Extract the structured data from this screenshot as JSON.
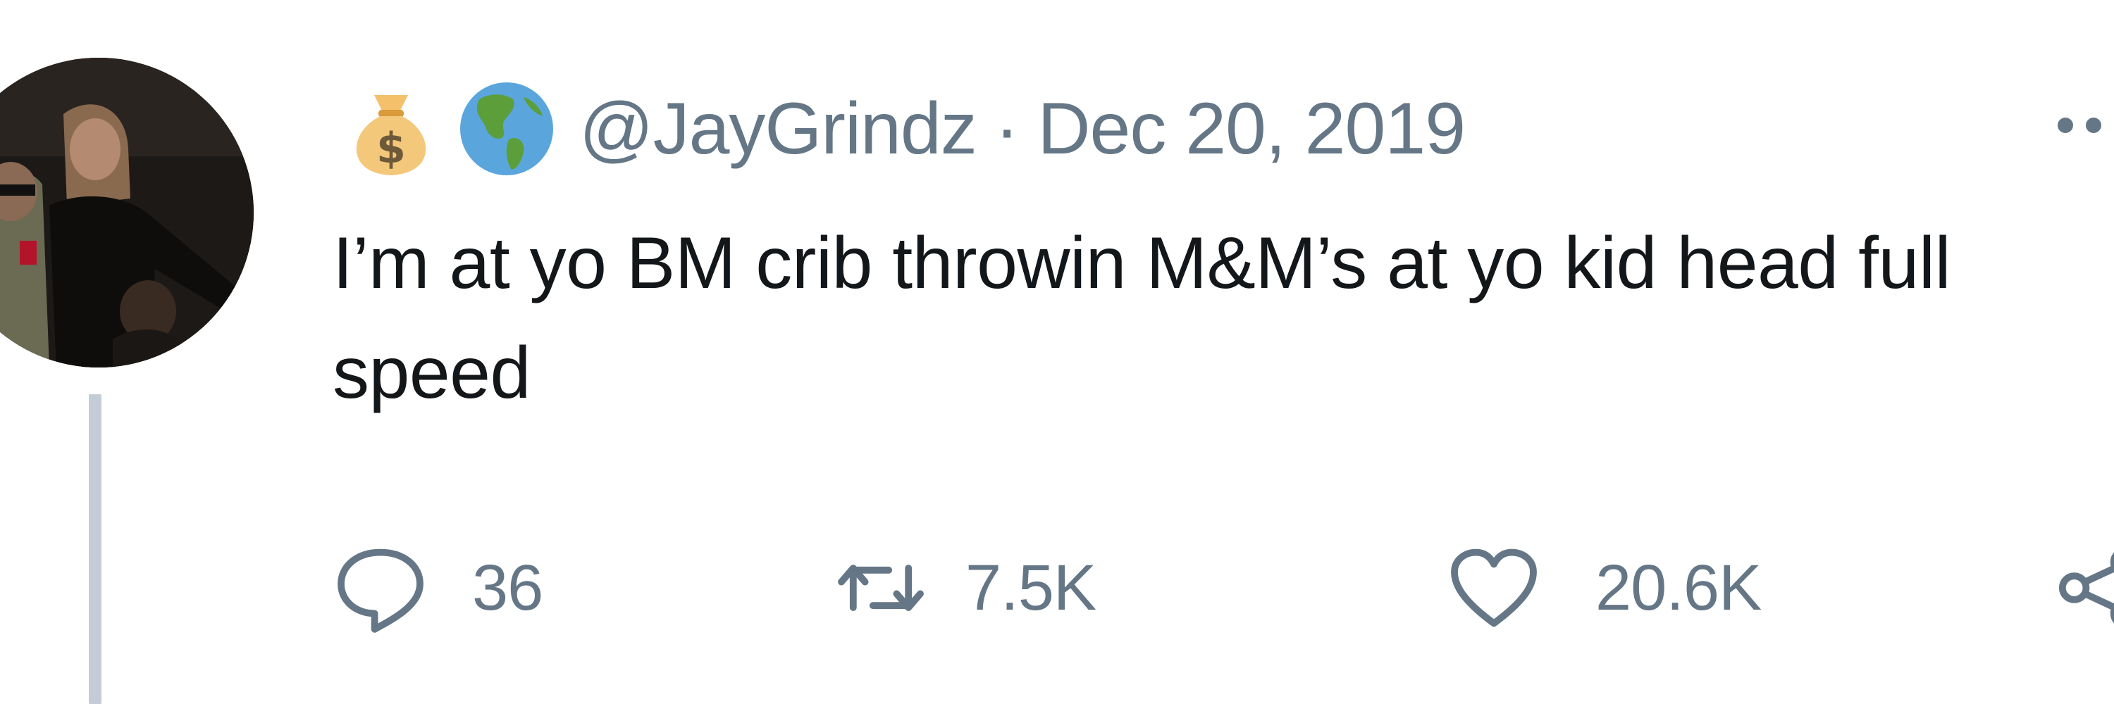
{
  "tweet": {
    "handle": "@JayGrindz",
    "separator": "·",
    "date": "Dec 20, 2019",
    "text": "I’m at yo BM crib throwin M&M’s at yo kid head full speed",
    "name_emojis": [
      "money-bag-icon",
      "globe-americas-icon"
    ],
    "actions": {
      "reply_count": "36",
      "retweet_count": "7.5K",
      "like_count": "20.6K"
    }
  },
  "colors": {
    "text": "#14171a",
    "secondary": "#657786",
    "thread_line": "#c4cdd5",
    "background": "#ffffff"
  }
}
